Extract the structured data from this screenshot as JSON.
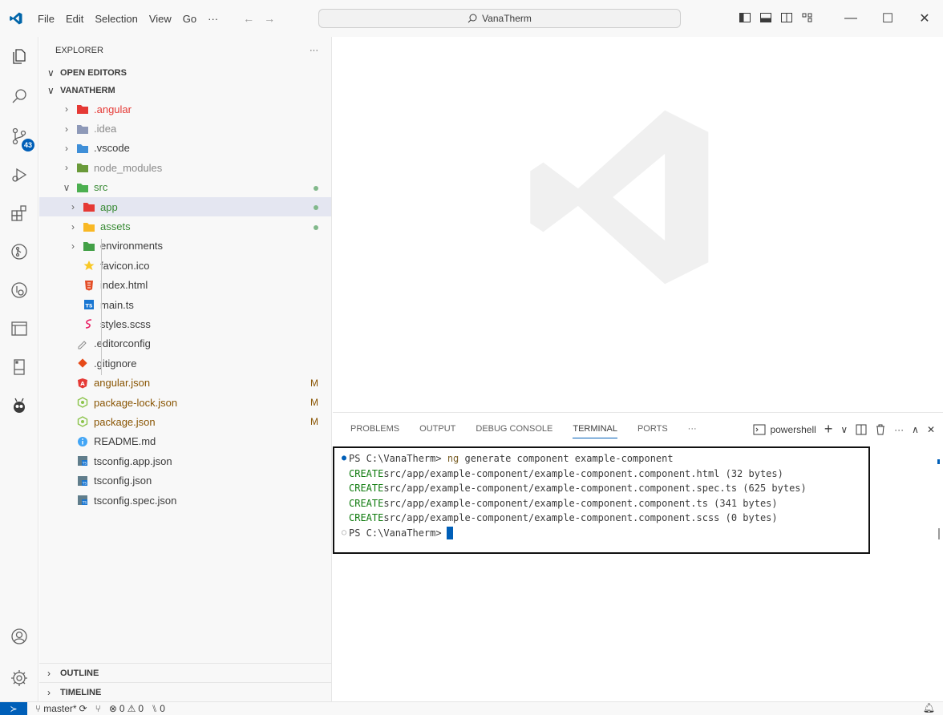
{
  "titlebar": {
    "menu": [
      "File",
      "Edit",
      "Selection",
      "View",
      "Go",
      "···"
    ],
    "search_text": "VanaTherm",
    "controls": [
      "—",
      "☐",
      "✕"
    ]
  },
  "activity": {
    "scm_badge": "43"
  },
  "sidebar": {
    "title": "EXPLORER",
    "more": "···",
    "open_editors": "OPEN EDITORS",
    "project": "VANATHERM",
    "items": [
      {
        "label": "angular",
        "prefix": ".",
        "depth": 1,
        "chevron": ">",
        "icon": "angular-folder-icon",
        "color": "#e53935"
      },
      {
        "label": ".idea",
        "depth": 1,
        "chevron": ">",
        "icon": "idea-folder-icon",
        "color": "#8a8a8a"
      },
      {
        "label": ".vscode",
        "depth": 1,
        "chevron": ">",
        "icon": "vscode-folder-icon",
        "color": "#3b3b3b"
      },
      {
        "label": "node_modules",
        "depth": 1,
        "chevron": ">",
        "icon": "node-folder-icon",
        "color": "#8a8a8a"
      },
      {
        "label": "src",
        "depth": 1,
        "chevron": "v",
        "icon": "src-folder-icon",
        "color": "#388a34"
      },
      {
        "label": "app",
        "depth": 2,
        "chevron": ">",
        "icon": "app-folder-icon",
        "color": "#388a34"
      },
      {
        "label": "assets",
        "depth": 2,
        "chevron": ">",
        "icon": "assets-folder-icon",
        "color": "#388a34"
      },
      {
        "label": "environments",
        "depth": 2,
        "chevron": ">",
        "icon": "env-folder-icon",
        "color": "#3b3b3b"
      },
      {
        "label": "favicon.ico",
        "depth": 2,
        "icon": "favicon-icon",
        "color": "#3b3b3b"
      },
      {
        "label": "index.html",
        "depth": 2,
        "icon": "html-file-icon",
        "color": "#3b3b3b"
      },
      {
        "label": "main.ts",
        "depth": 2,
        "icon": "ts-file-icon",
        "color": "#3b3b3b"
      },
      {
        "label": "styles.scss",
        "depth": 2,
        "icon": "scss-file-icon",
        "color": "#3b3b3b"
      },
      {
        "label": ".editorconfig",
        "depth": 1,
        "icon": "editorconfig-icon",
        "color": "#3b3b3b"
      },
      {
        "label": ".gitignore",
        "depth": 1,
        "icon": "git-icon",
        "color": "#3b3b3b"
      },
      {
        "label": "angular.json",
        "depth": 1,
        "icon": "angular-file-icon",
        "color": "#895503",
        "deco": "M"
      },
      {
        "label": "package-lock.json",
        "depth": 1,
        "icon": "npm-file-icon",
        "color": "#895503",
        "deco": "M"
      },
      {
        "label": "package.json",
        "depth": 1,
        "icon": "npm-file-icon",
        "color": "#895503",
        "deco": "M"
      },
      {
        "label": "README.md",
        "depth": 1,
        "icon": "info-icon",
        "color": "#3b3b3b"
      },
      {
        "label": "tsconfig.app.json",
        "depth": 1,
        "icon": "tsconfig-icon",
        "color": "#3b3b3b"
      },
      {
        "label": "tsconfig.json",
        "depth": 1,
        "icon": "tsconfig-icon",
        "color": "#3b3b3b"
      },
      {
        "label": "tsconfig.spec.json",
        "depth": 1,
        "icon": "tsconfig-icon",
        "color": "#3b3b3b"
      }
    ],
    "outline": "OUTLINE",
    "timeline": "TIMELINE"
  },
  "panel": {
    "tabs": [
      "PROBLEMS",
      "OUTPUT",
      "DEBUG CONSOLE",
      "TERMINAL",
      "PORTS"
    ],
    "more": "···",
    "active_tab": "TERMINAL",
    "shell": "powershell",
    "terminal": {
      "prompt": "PS C:\\VanaTherm>",
      "command": "ng",
      "command_args": "generate component example-component",
      "lines": [
        {
          "kind": "CREATE",
          "text": "src/app/example-component/example-component.component.html (32 bytes)"
        },
        {
          "kind": "CREATE",
          "text": "src/app/example-component/example-component.component.spec.ts (625 bytes)"
        },
        {
          "kind": "CREATE",
          "text": "src/app/example-component/example-component.component.ts (341 bytes)"
        },
        {
          "kind": "CREATE",
          "text": "src/app/example-component/example-component.component.scss (0 bytes)"
        }
      ],
      "prompt2": "PS C:\\VanaTherm>"
    }
  },
  "statusbar": {
    "branch": "master*",
    "errors": "0",
    "warnings": "0",
    "ports": "0"
  }
}
